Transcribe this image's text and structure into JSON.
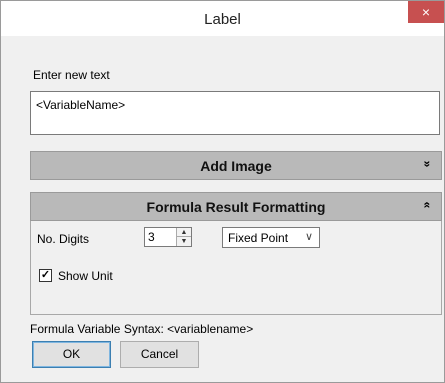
{
  "window": {
    "title": "Label",
    "close_glyph": "×"
  },
  "text_section": {
    "label": "Enter new text",
    "value": "<VariableName>"
  },
  "add_image": {
    "title": "Add Image",
    "chevron": "»"
  },
  "formula": {
    "title": "Formula Result Formatting",
    "chevron": "«",
    "digits_label": "No. Digits",
    "digits_value": "3",
    "format_value": "Fixed Point",
    "show_unit_label": "Show Unit",
    "show_unit_checked": true
  },
  "syntax_text": "Formula Variable Syntax: <variablename>",
  "buttons": {
    "ok": "OK",
    "cancel": "Cancel"
  },
  "colors": {
    "close_red": "#c75050",
    "header_gray": "#b9b9b9"
  }
}
